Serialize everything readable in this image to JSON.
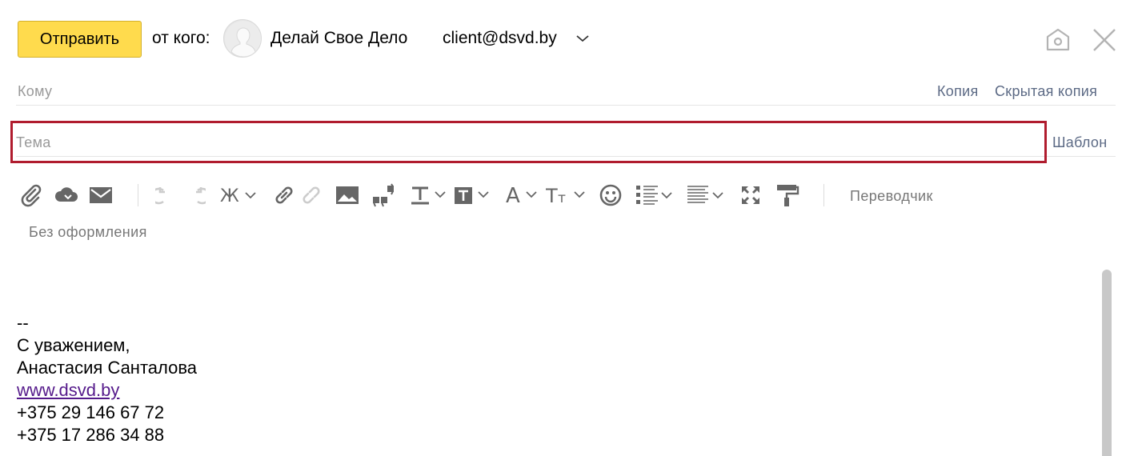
{
  "header": {
    "send_label": "Отправить",
    "from_label": "от кого:",
    "sender_name": "Делай Свое Дело",
    "sender_email": "client@dsvd.by"
  },
  "fields": {
    "to_placeholder": "Кому",
    "cc_label": "Копия",
    "bcc_label": "Скрытая копия",
    "subject_placeholder": "Тема",
    "subject_value": "",
    "template_label": "Шаблон"
  },
  "toolbar": {
    "icons": [
      "attach-icon",
      "cloud-attach-icon",
      "mail-attach-icon",
      "undo-icon",
      "redo-icon",
      "bold-icon",
      "link-icon",
      "unlink-icon",
      "image-icon",
      "quote-icon",
      "text-color-icon",
      "text-background-icon",
      "font-icon",
      "font-size-icon",
      "emoji-icon",
      "list-icon",
      "align-icon",
      "fullscreen-icon",
      "format-paint-icon"
    ],
    "translator_label": "Переводчик",
    "plain_format_label": "Без оформления"
  },
  "body": {
    "signature": {
      "separator": "--",
      "greeting": "С уважением,",
      "name": "Анастасия Санталова",
      "website": "www.dsvd.by",
      "phone1": "+375 29 146 67 72",
      "phone2": "+375 17 286 34 88"
    }
  },
  "colors": {
    "send_button": "#ffdb4d",
    "highlight": "#b01c2e",
    "link": "#5c6a85",
    "visited_link": "#551a8b"
  }
}
